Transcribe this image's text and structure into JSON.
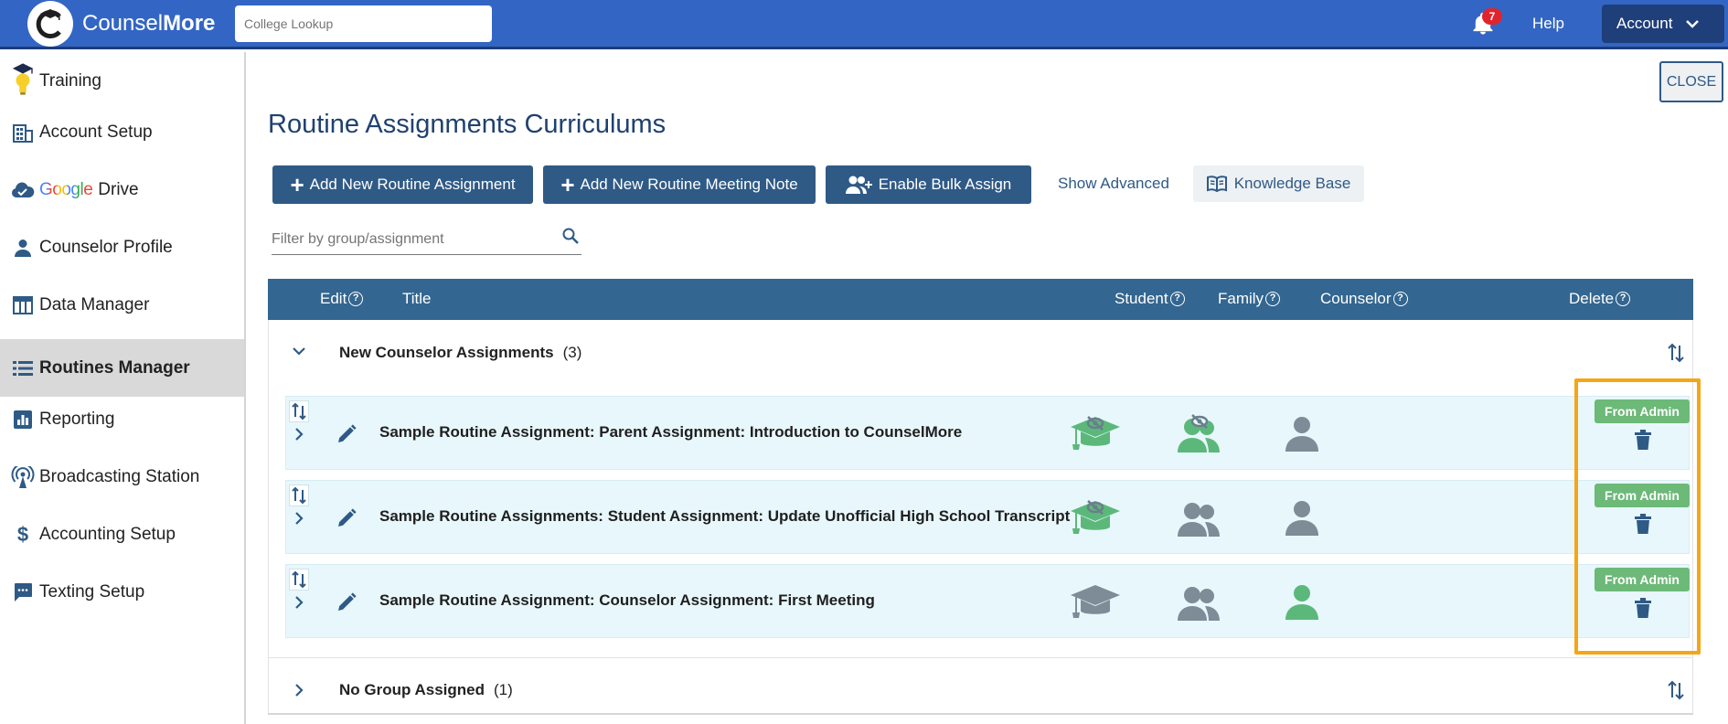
{
  "header": {
    "brand_light": "Counsel",
    "brand_bold": "More",
    "lookup_placeholder": "College Lookup",
    "notification_count": "7",
    "help_label": "Help",
    "account_label": "Account"
  },
  "sidebar": {
    "items": [
      {
        "label": "Training",
        "icon": "lightbulb-graduate-icon"
      },
      {
        "label": "Account Setup",
        "icon": "building-icon"
      },
      {
        "label_prefix": "Google",
        "label": "Drive",
        "icon": "cloud-check-icon"
      },
      {
        "label": "Counselor Profile",
        "icon": "person-icon"
      },
      {
        "label": "Data Manager",
        "icon": "table-icon"
      },
      {
        "label": "Routines Manager",
        "icon": "list-icon",
        "active": true
      },
      {
        "label": "Reporting",
        "icon": "bar-chart-icon"
      },
      {
        "label": "Broadcasting Station",
        "icon": "broadcast-icon"
      },
      {
        "label": "Accounting Setup",
        "icon": "dollar-icon"
      },
      {
        "label": "Texting Setup",
        "icon": "chat-icon"
      }
    ]
  },
  "main": {
    "close_label": "CLOSE",
    "title": "Routine Assignments Curriculums",
    "buttons": {
      "add_assignment": "Add New Routine Assignment",
      "add_meeting_note": "Add New Routine Meeting Note",
      "bulk_assign": "Enable Bulk Assign",
      "show_advanced": "Show Advanced",
      "knowledge_base": "Knowledge Base"
    },
    "filter_placeholder": "Filter by group/assignment"
  },
  "table": {
    "columns": {
      "edit": "Edit",
      "title": "Title",
      "student": "Student",
      "family": "Family",
      "counselor": "Counselor",
      "delete": "Delete"
    },
    "groups": [
      {
        "name": "New Counselor Assignments",
        "count": "(3)",
        "expanded": true,
        "rows": [
          {
            "title": "Sample Routine Assignment: Parent Assignment: Introduction to CounselMore",
            "student": "hidden-active",
            "family": "hidden-active",
            "counselor": "inactive",
            "badge": "From Admin"
          },
          {
            "title": "Sample Routine Assignments: Student Assignment: Update Unofficial High School Transcript",
            "student": "hidden-active",
            "family": "inactive",
            "counselor": "inactive",
            "badge": "From Admin"
          },
          {
            "title": "Sample Routine Assignment: Counselor Assignment: First Meeting",
            "student": "inactive",
            "family": "inactive",
            "counselor": "active",
            "badge": "From Admin"
          }
        ]
      },
      {
        "name": "No Group Assigned",
        "count": "(1)",
        "expanded": false,
        "rows": []
      }
    ]
  },
  "colors": {
    "topbar": "#3366c4",
    "primary_dark": "#2f5a86",
    "icon_active_green": "#5cb87a",
    "icon_inactive_gray": "#7d8c97",
    "badge_green": "#6cb978",
    "highlight_orange": "#f5a616",
    "row_bg": "#e8f7fc"
  }
}
